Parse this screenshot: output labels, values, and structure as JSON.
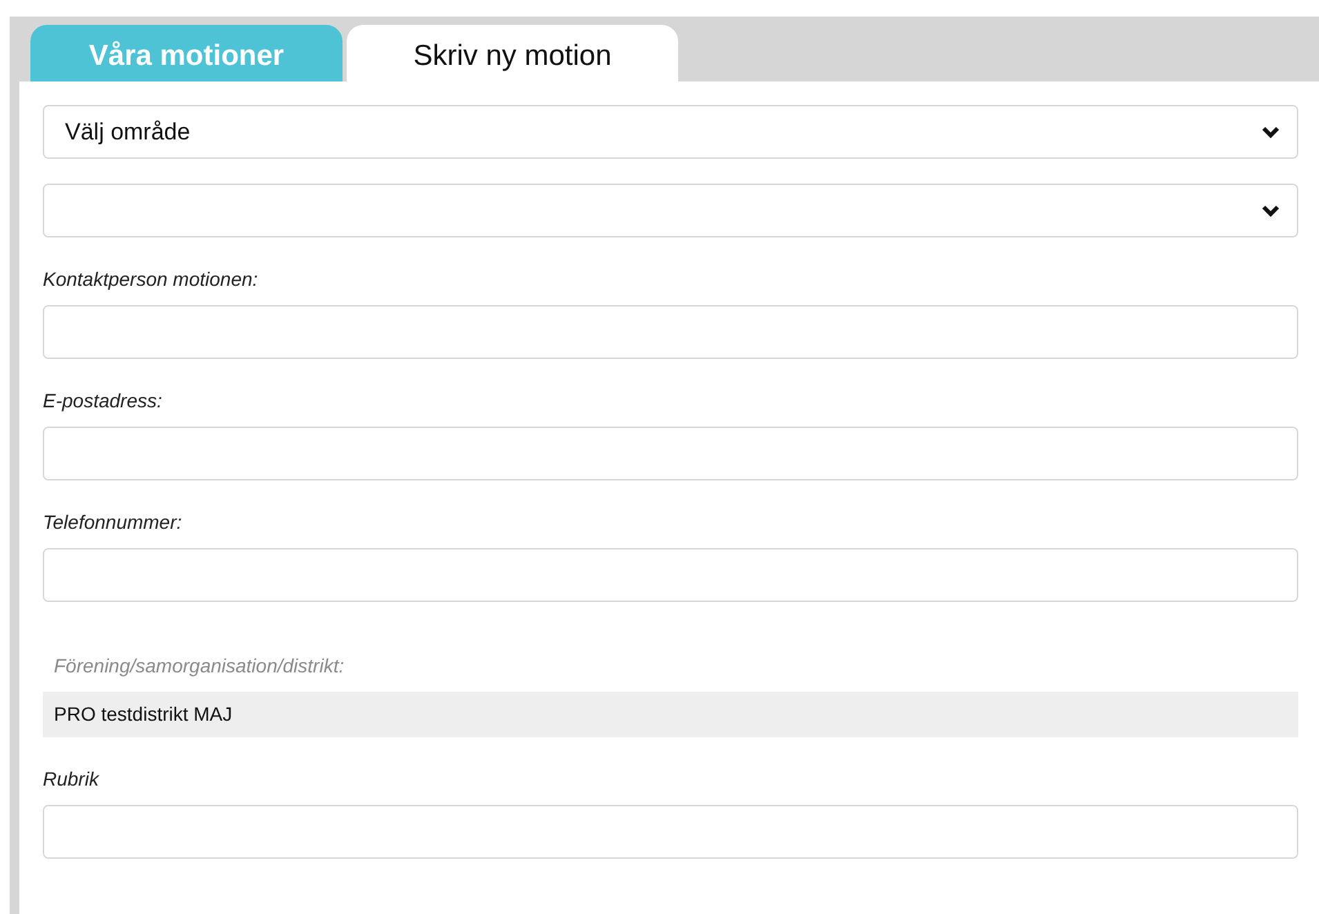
{
  "tabs": [
    {
      "label": "Våra motioner",
      "selected": false
    },
    {
      "label": "Skriv ny motion",
      "selected": true
    }
  ],
  "fields": [
    {
      "kind": "select",
      "value": "Välj område"
    },
    {
      "kind": "select"
    },
    {
      "kind": "text",
      "label": "Kontaktperson motionen:"
    },
    {
      "kind": "text",
      "label": "E-postadress:"
    },
    {
      "kind": "text",
      "label": "Telefonnummer:"
    },
    {
      "kind": "readonly",
      "label": "Förening/samorganisation/distrikt:",
      "value": "PRO testdistrikt MAJ"
    },
    {
      "kind": "text",
      "label": "Rubrik"
    }
  ]
}
